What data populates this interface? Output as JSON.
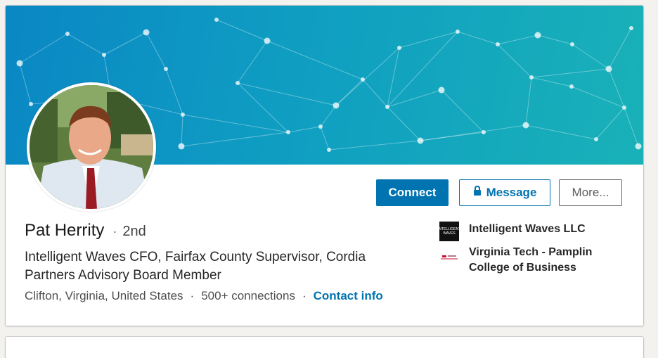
{
  "profile": {
    "name": "Pat Herrity",
    "degree": "2nd",
    "degree_separator": "·",
    "headline": "Intelligent Waves CFO, Fairfax County Supervisor, Cordia Partners Advisory Board Member",
    "location": "Clifton, Virginia, United States",
    "connections": "500+ connections",
    "contact_info": "Contact info"
  },
  "actions": {
    "connect": "Connect",
    "message": "Message",
    "more": "More..."
  },
  "experience": [
    {
      "name": "Intelligent Waves LLC",
      "logo_text": "INTELLIGENT WAVES",
      "icon": "company-logo-icon"
    },
    {
      "name": "Virginia Tech - Pamplin College of Business",
      "icon": "school-logo-icon"
    }
  ],
  "colors": {
    "accent": "#0073b1",
    "banner_start": "#0a87c4",
    "banner_end": "#19b1b8"
  }
}
